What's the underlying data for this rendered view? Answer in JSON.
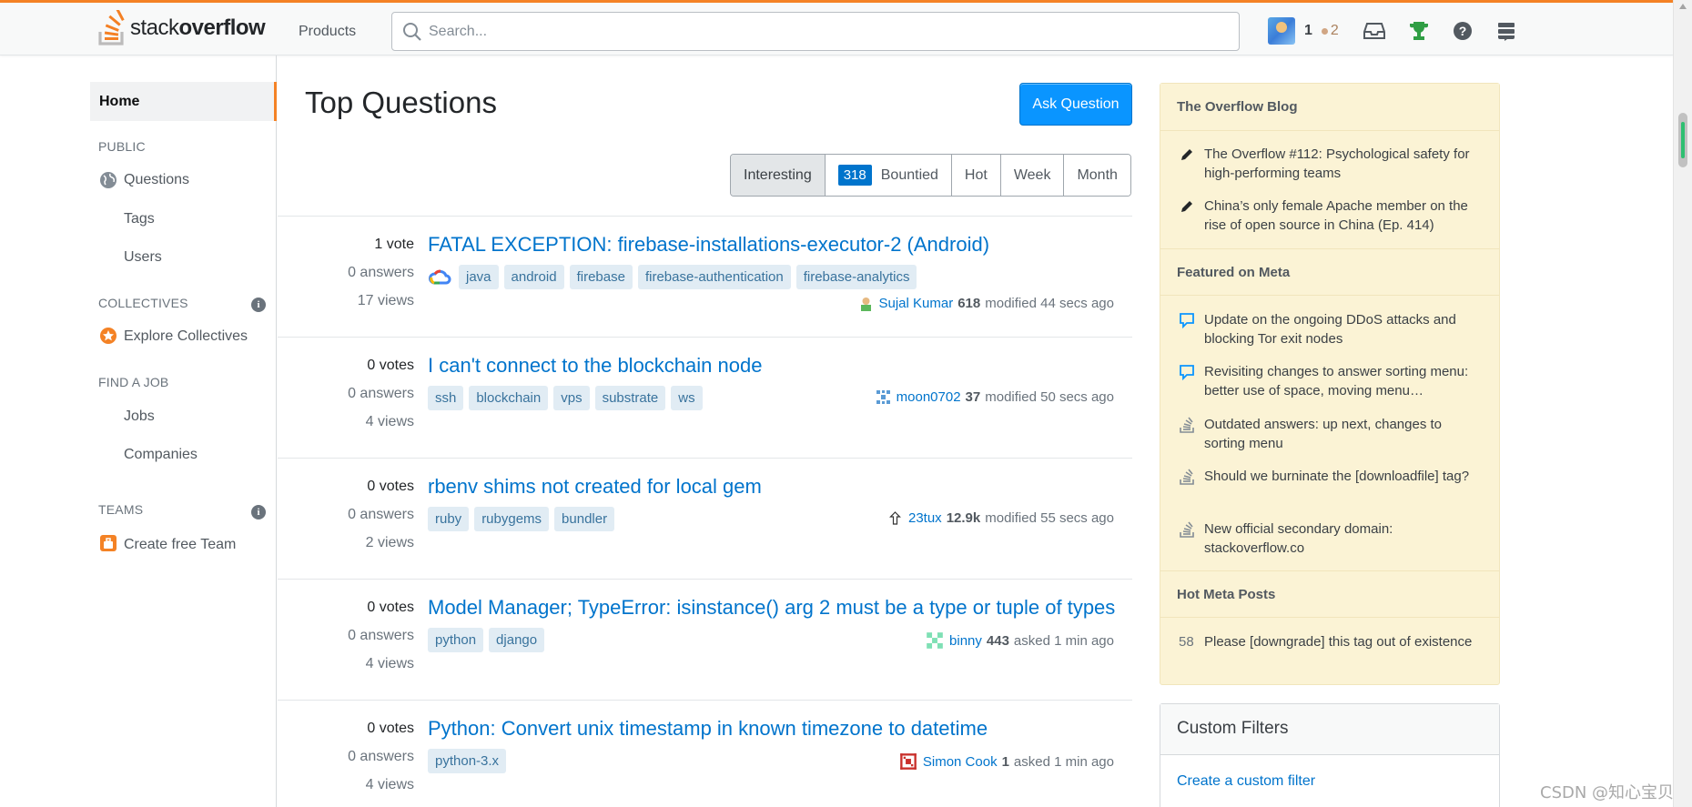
{
  "header": {
    "logo_light": "stack",
    "logo_bold": "overflow",
    "products_label": "Products",
    "search_placeholder": "Search...",
    "reputation": "1",
    "bronze_badges": "2"
  },
  "left_nav": {
    "home": "Home",
    "public_label": "PUBLIC",
    "questions": "Questions",
    "tags": "Tags",
    "users": "Users",
    "collectives_label": "COLLECTIVES",
    "explore_collectives": "Explore Collectives",
    "find_job_label": "FIND A JOB",
    "jobs": "Jobs",
    "companies": "Companies",
    "teams_label": "TEAMS",
    "create_team": "Create free Team",
    "info_glyph": "i"
  },
  "main": {
    "title": "Top Questions",
    "ask_button": "Ask Question",
    "filters": {
      "interesting": "Interesting",
      "bountied_count": "318",
      "bountied": "Bountied",
      "hot": "Hot",
      "week": "Week",
      "month": "Month"
    },
    "questions": [
      {
        "votes": "1 vote",
        "answers": "0 answers",
        "views": "17 views",
        "title": "FATAL EXCEPTION: firebase-installations-executor-2 (Android)",
        "tags": [
          "java",
          "android",
          "firebase",
          "firebase-authentication",
          "firebase-analytics"
        ],
        "user": "Sujal Kumar",
        "rep": "618",
        "action": "modified 44 secs ago"
      },
      {
        "votes": "0 votes",
        "answers": "0 answers",
        "views": "4 views",
        "title": "I can't connect to the blockchain node",
        "tags": [
          "ssh",
          "blockchain",
          "vps",
          "substrate",
          "ws"
        ],
        "user": "moon0702",
        "rep": "37",
        "action": "modified 50 secs ago"
      },
      {
        "votes": "0 votes",
        "answers": "0 answers",
        "views": "2 views",
        "title": "rbenv shims not created for local gem",
        "tags": [
          "ruby",
          "rubygems",
          "bundler"
        ],
        "user": "23tux",
        "rep": "12.9k",
        "action": "modified 55 secs ago"
      },
      {
        "votes": "0 votes",
        "answers": "0 answers",
        "views": "4 views",
        "title": "Model Manager; TypeError: isinstance() arg 2 must be a type or tuple of types",
        "tags": [
          "python",
          "django"
        ],
        "user": "binny",
        "rep": "443",
        "action": "asked 1 min ago"
      },
      {
        "votes": "0 votes",
        "answers": "0 answers",
        "views": "4 views",
        "title": "Python: Convert unix timestamp in known timezone to datetime",
        "tags": [
          "python-3.x"
        ],
        "user": "Simon Cook",
        "rep": "1",
        "action": "asked 1 min ago"
      }
    ]
  },
  "sidebar": {
    "blog_header": "The Overflow Blog",
    "blog_items": [
      "The Overflow #112: Psychological safety for high-performing teams",
      "China’s only female Apache member on the rise of open source in China (Ep. 414)"
    ],
    "meta_header": "Featured on Meta",
    "meta_items": [
      "Update on the ongoing DDoS attacks and blocking Tor exit nodes",
      "Revisiting changes to answer sorting menu: better use of space, moving menu…",
      "Outdated answers: up next, changes to sorting menu",
      "Should we burninate the [downloadfile] tag?",
      "New official secondary domain: stackoverflow.co"
    ],
    "hot_header": "Hot Meta Posts",
    "hot_items": [
      {
        "score": "58",
        "title": "Please [downgrade] this tag out of existence"
      }
    ],
    "filters_header": "Custom Filters",
    "filters_link": "Create a custom filter"
  },
  "watermark": "CSDN @知心宝贝",
  "colors": {
    "accent": "#f48225",
    "link": "#0074cc",
    "button": "#0a95ff",
    "tag_bg": "#e1ecf4",
    "tag_fg": "#39739d",
    "yellow_widget": "#fbf3d5"
  }
}
